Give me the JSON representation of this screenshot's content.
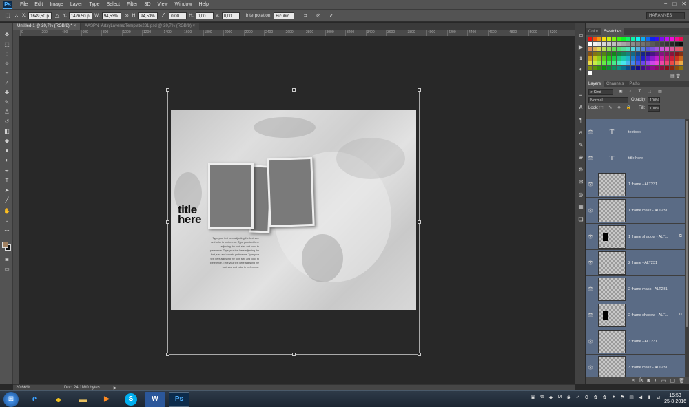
{
  "app": {
    "logo": "Ps",
    "menu": [
      "File",
      "Edit",
      "Image",
      "Layer",
      "Type",
      "Select",
      "Filter",
      "3D",
      "View",
      "Window",
      "Help"
    ],
    "window_controls": [
      "−",
      "□",
      "✕"
    ]
  },
  "options_bar": {
    "x_label": "X:",
    "x_value": "1649,50 p",
    "y_label": "Y:",
    "y_value": "1426,50 p",
    "w_label": "W:",
    "w_value": "94,53%",
    "h_label": "H:",
    "h_value": "94,53%",
    "angle_value": "0,00",
    "h_skew_label": "H:",
    "h_skew_value": "0,00",
    "v_skew_label": "V:",
    "v_skew_value": "0,00",
    "interpolation_label": "Interpolation:",
    "interpolation_value": "Bicubic",
    "workspace": "HARANNES"
  },
  "tabs": [
    {
      "label": "Untitled-1 @ 20,7% (RGB/8) *",
      "active": true
    },
    {
      "label": "AASPN_ArtsyLayeredTemplate231.psd @ 20,7% (RGB/8)",
      "active": false
    }
  ],
  "ruler_ticks": [
    "0",
    "200",
    "400",
    "600",
    "800",
    "1000",
    "1200",
    "1400",
    "1600",
    "1800",
    "2000",
    "2200",
    "2400",
    "2600",
    "2800",
    "3000",
    "3200",
    "3400",
    "3600",
    "3800",
    "4000",
    "4200",
    "4400",
    "4600",
    "4800",
    "5000",
    "5200"
  ],
  "document": {
    "title": "title\nhere",
    "body": "Type your text here adjusting the font, size and color to preference. Type your text here adjusting the font, size and color to preference. Type your text here adjusting the font, size and color to preference. Type your text here adjusting the font, size and color to preference. Type your text here adjusting the font, size and color to preference."
  },
  "status": {
    "zoom": "20,66%",
    "doc": "Doc: 24,1M/0 bytes"
  },
  "swatches_panel": {
    "tabs": [
      "Color",
      "Swatches"
    ],
    "active_tab": "Swatches"
  },
  "layers_panel": {
    "tabs": [
      "Layers",
      "Channels",
      "Paths"
    ],
    "kind_label": "Kind",
    "blend_mode": "Normal",
    "opacity_label": "Opacity:",
    "opacity_value": "100%",
    "lock_label": "Lock:",
    "fill_label": "Fill:",
    "fill_value": "100%",
    "layers": [
      {
        "name": "textbox",
        "type": "text",
        "selected": true,
        "fx": false
      },
      {
        "name": "title here",
        "type": "text",
        "selected": true,
        "fx": false
      },
      {
        "name": "1 frame - ALT231",
        "type": "raster",
        "selected": true,
        "fx": false
      },
      {
        "name": "1 frame mask - ALT231",
        "type": "raster",
        "selected": true,
        "fx": false
      },
      {
        "name": "1 frame shadow - ALT...",
        "type": "shadow",
        "selected": true,
        "fx": true
      },
      {
        "name": "2 frame - ALT231",
        "type": "raster",
        "selected": true,
        "fx": false
      },
      {
        "name": "2 frame mask - ALT231",
        "type": "raster",
        "selected": true,
        "fx": false
      },
      {
        "name": "2 frame shadow - ALT...",
        "type": "shadow",
        "selected": true,
        "fx": true
      },
      {
        "name": "3 frame - ALT231",
        "type": "raster",
        "selected": true,
        "fx": false
      },
      {
        "name": "3 frame mask - ALT231",
        "type": "raster",
        "selected": true,
        "fx": false
      }
    ]
  },
  "taskbar": {
    "apps": [
      "e",
      "●",
      "▬",
      "▶",
      "S",
      "W",
      "Ps"
    ],
    "time": "15:53",
    "date": "25-8-2016"
  }
}
